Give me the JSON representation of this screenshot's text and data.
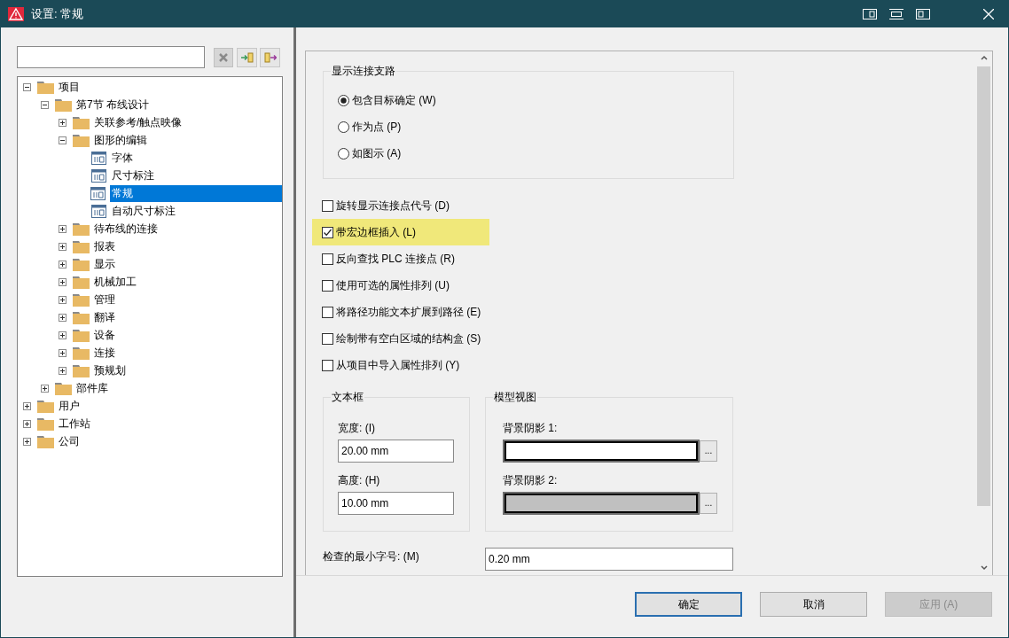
{
  "window": {
    "title": "设置: 常规"
  },
  "tree": [
    {
      "label": "项目",
      "kind": "folder",
      "expanded": true,
      "selected": false,
      "children": [
        {
          "label": "第7节 布线设计",
          "kind": "folder",
          "expanded": true,
          "selected": false,
          "children": [
            {
              "label": "关联参考/触点映像",
              "kind": "folder",
              "expanded": false,
              "selected": false
            },
            {
              "label": "图形的编辑",
              "kind": "folder",
              "expanded": true,
              "selected": false,
              "children": [
                {
                  "label": "字体",
                  "kind": "page",
                  "selected": false
                },
                {
                  "label": "尺寸标注",
                  "kind": "page",
                  "selected": false
                },
                {
                  "label": "常规",
                  "kind": "page",
                  "selected": true
                },
                {
                  "label": "自动尺寸标注",
                  "kind": "page",
                  "selected": false
                }
              ]
            },
            {
              "label": "待布线的连接",
              "kind": "folder",
              "expanded": false,
              "selected": false
            },
            {
              "label": "报表",
              "kind": "folder",
              "expanded": false,
              "selected": false
            },
            {
              "label": "显示",
              "kind": "folder",
              "expanded": false,
              "selected": false
            },
            {
              "label": "机械加工",
              "kind": "folder",
              "expanded": false,
              "selected": false
            },
            {
              "label": "管理",
              "kind": "folder",
              "expanded": false,
              "selected": false
            },
            {
              "label": "翻译",
              "kind": "folder",
              "expanded": false,
              "selected": false
            },
            {
              "label": "设备",
              "kind": "folder",
              "expanded": false,
              "selected": false
            },
            {
              "label": "连接",
              "kind": "folder",
              "expanded": false,
              "selected": false
            },
            {
              "label": "预规划",
              "kind": "folder",
              "expanded": false,
              "selected": false
            }
          ]
        },
        {
          "label": "部件库",
          "kind": "folder",
          "expanded": false,
          "selected": false
        }
      ]
    },
    {
      "label": "用户",
      "kind": "folder",
      "expanded": false,
      "selected": false
    },
    {
      "label": "工作站",
      "kind": "folder",
      "expanded": false,
      "selected": false
    },
    {
      "label": "公司",
      "kind": "folder",
      "expanded": false,
      "selected": false
    }
  ],
  "branch_group": {
    "title": "显示连接支路",
    "options": [
      {
        "label": "包含目标确定 (W)",
        "selected": true
      },
      {
        "label": "作为点 (P)",
        "selected": false
      },
      {
        "label": "如图示 (A)",
        "selected": false
      }
    ]
  },
  "checkboxes": [
    {
      "label": "旋转显示连接点代号 (D)",
      "checked": false,
      "highlighted": false
    },
    {
      "label": "带宏边框插入 (L)",
      "checked": true,
      "highlighted": true
    },
    {
      "label": "反向查找 PLC 连接点 (R)",
      "checked": false,
      "highlighted": false
    },
    {
      "label": "使用可选的属性排列 (U)",
      "checked": false,
      "highlighted": false
    },
    {
      "label": "将路径功能文本扩展到路径 (E)",
      "checked": false,
      "highlighted": false
    },
    {
      "label": "绘制带有空白区域的结构盒 (S)",
      "checked": false,
      "highlighted": false
    },
    {
      "label": "从项目中导入属性排列 (Y)",
      "checked": false,
      "highlighted": false
    }
  ],
  "text_frame": {
    "title": "文本框",
    "fields": [
      {
        "label": "宽度: (I)",
        "value": "20.00 mm"
      },
      {
        "label": "高度: (H)",
        "value": "10.00 mm"
      }
    ]
  },
  "model_view": {
    "title": "模型视图",
    "fields": [
      {
        "label": "背景阴影 1:",
        "color": "#ffffff",
        "button": "..."
      },
      {
        "label": "背景阴影 2:",
        "color": "#c0c0c0",
        "button": "..."
      }
    ]
  },
  "min_font": {
    "label": "检查的最小字号: (M)",
    "value": "0.20 mm"
  },
  "buttons": [
    {
      "label": "确定",
      "default": true,
      "disabled": false
    },
    {
      "label": "取消",
      "default": false,
      "disabled": false
    },
    {
      "label": "应用 (A)",
      "default": false,
      "disabled": true
    }
  ]
}
